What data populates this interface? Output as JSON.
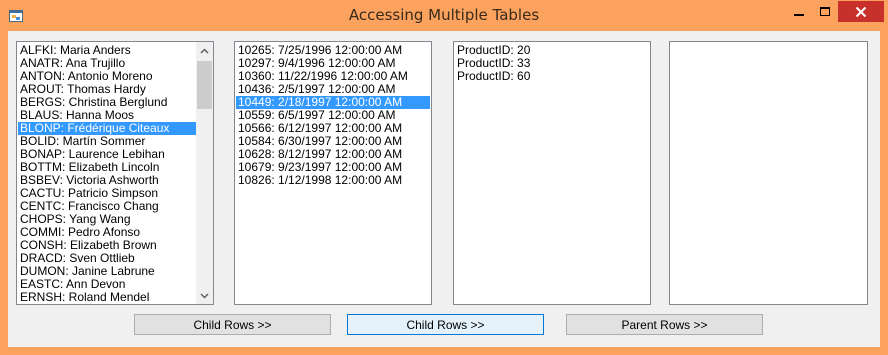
{
  "window": {
    "title": "Accessing Multiple Tables",
    "accent_color": "#fba25e",
    "close_color": "#c7302b"
  },
  "customers": {
    "items": [
      "ALFKI: Maria Anders",
      "ANATR: Ana Trujillo",
      "ANTON: Antonio Moreno",
      "AROUT: Thomas Hardy",
      "BERGS: Christina Berglund",
      "BLAUS: Hanna Moos",
      "BLONP: Frédérique Citeaux",
      "BOLID: Martín Sommer",
      "BONAP: Laurence Lebihan",
      "BOTTM: Elizabeth Lincoln",
      "BSBEV: Victoria Ashworth",
      "CACTU: Patricio Simpson",
      "CENTC: Francisco Chang",
      "CHOPS: Yang Wang",
      "COMMI: Pedro Afonso",
      "CONSH: Elizabeth Brown",
      "DRACD: Sven Ottlieb",
      "DUMON: Janine Labrune",
      "EASTC: Ann Devon",
      "ERNSH: Roland Mendel"
    ],
    "selected": "BLONP: Frédérique Citeaux"
  },
  "orders": {
    "items": [
      "10265: 7/25/1996 12:00:00 AM",
      "10297: 9/4/1996 12:00:00 AM",
      "10360: 11/22/1996 12:00:00 AM",
      "10436: 2/5/1997 12:00:00 AM",
      "10449: 2/18/1997 12:00:00 AM",
      "10559: 6/5/1997 12:00:00 AM",
      "10566: 6/12/1997 12:00:00 AM",
      "10584: 6/30/1997 12:00:00 AM",
      "10628: 8/12/1997 12:00:00 AM",
      "10679: 9/23/1997 12:00:00 AM",
      "10826: 1/12/1998 12:00:00 AM"
    ],
    "selected": "10449: 2/18/1997 12:00:00 AM"
  },
  "products": {
    "items": [
      "ProductID: 20",
      "ProductID: 33",
      "ProductID: 60"
    ]
  },
  "buttons": {
    "child_rows_1": "Child Rows >>",
    "child_rows_2": "Child Rows >>",
    "parent_rows": "Parent Rows >>"
  },
  "icons": {
    "app": "app-icon",
    "minimize": "minimize-icon",
    "maximize": "maximize-icon",
    "close": "close-icon",
    "scroll_up": "chevron-up-icon",
    "scroll_down": "chevron-down-icon"
  }
}
